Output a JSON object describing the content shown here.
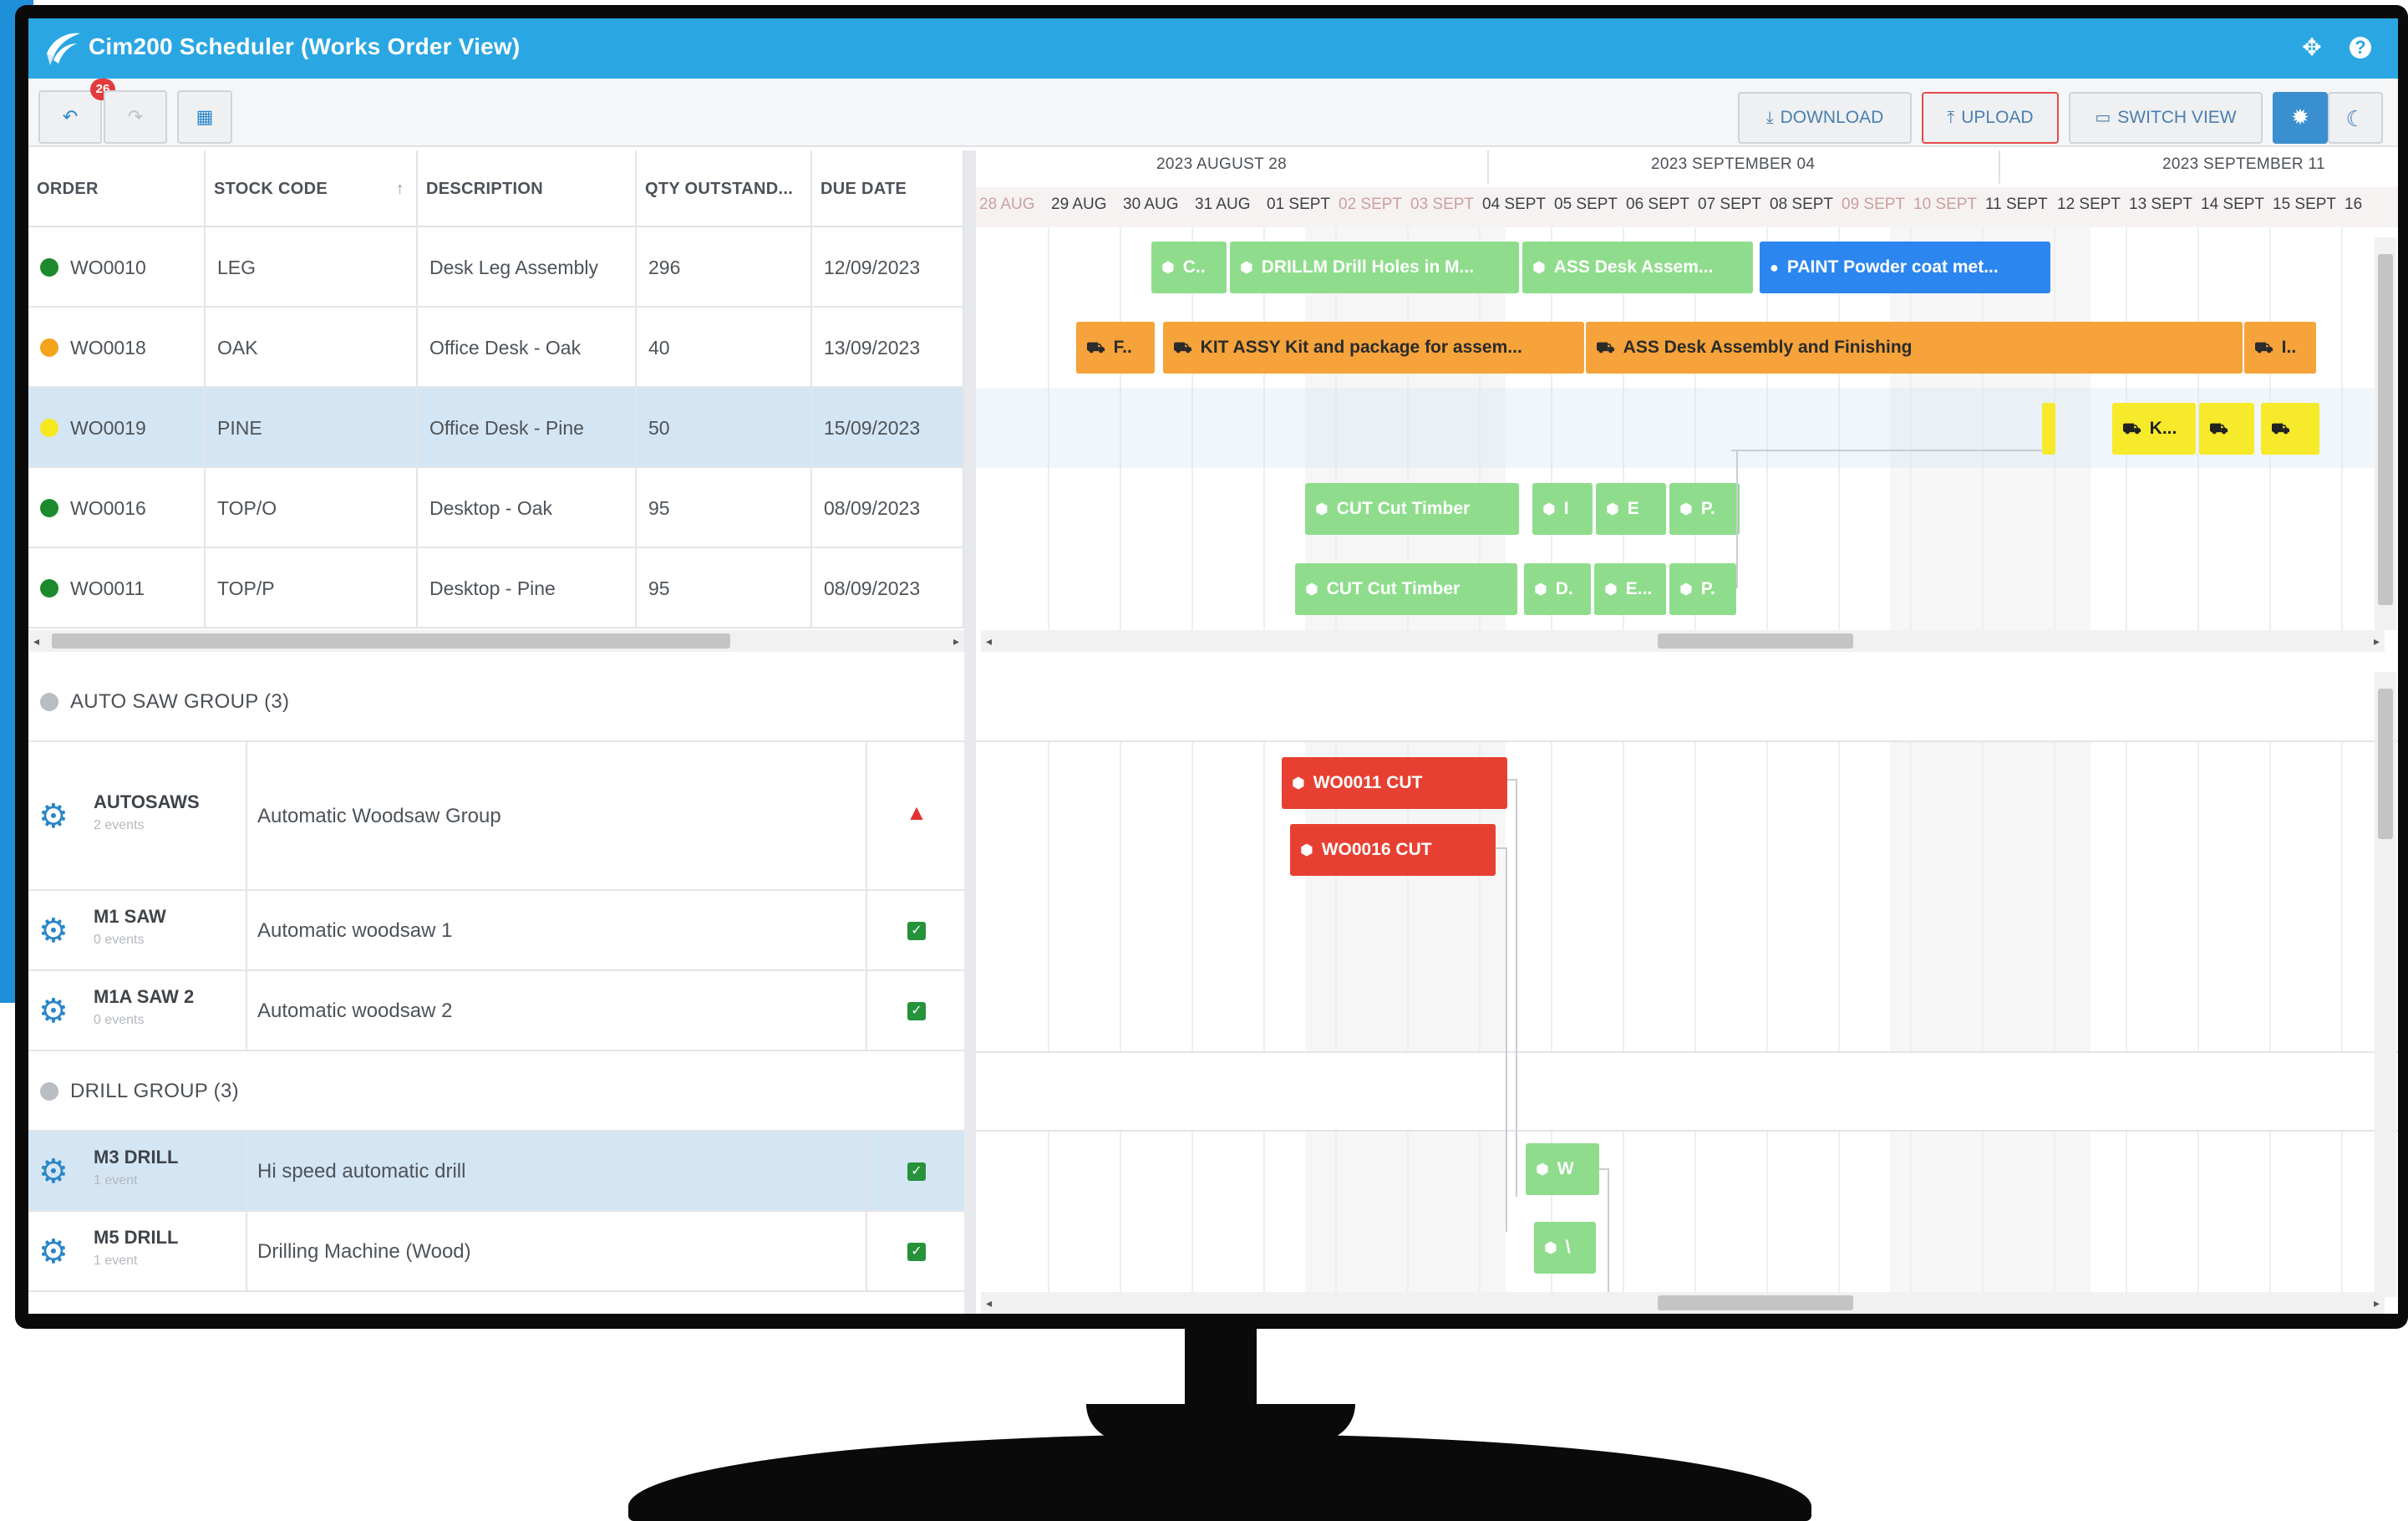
{
  "app": {
    "title": "Cim200 Scheduler (Works Order View)"
  },
  "toolbar": {
    "undo_badge": "26",
    "download": "DOWNLOAD",
    "upload": "UPLOAD",
    "switch_view": "SWITCH VIEW"
  },
  "grid": {
    "columns": [
      "ORDER",
      "STOCK CODE",
      "DESCRIPTION",
      "QTY OUTSTAND...",
      "DUE DATE"
    ],
    "rows": [
      {
        "order": "WO0010",
        "stock": "LEG",
        "desc": "Desk Leg Assembly",
        "qty": "296",
        "due": "12/09/2023",
        "status_color": "#1c8a2c"
      },
      {
        "order": "WO0018",
        "stock": "OAK",
        "desc": "Office Desk - Oak",
        "qty": "40",
        "due": "13/09/2023",
        "status_color": "#f4a31c"
      },
      {
        "order": "WO0019",
        "stock": "PINE",
        "desc": "Office Desk - Pine",
        "qty": "50",
        "due": "15/09/2023",
        "status_color": "#f6e81c"
      },
      {
        "order": "WO0016",
        "stock": "TOP/O",
        "desc": "Desktop - Oak",
        "qty": "95",
        "due": "08/09/2023",
        "status_color": "#1c8a2c"
      },
      {
        "order": "WO0011",
        "stock": "TOP/P",
        "desc": "Desktop - Pine",
        "qty": "95",
        "due": "08/09/2023",
        "status_color": "#1c8a2c"
      }
    ]
  },
  "timeline": {
    "weeks": [
      "2023 AUGUST 28",
      "2023 SEPTEMBER 04",
      "2023 SEPTEMBER 11"
    ],
    "days": [
      "28 AUG",
      "29 AUG",
      "30 AUG",
      "31 AUG",
      "01 SEPT",
      "02 SEPT",
      "03 SEPT",
      "04 SEPT",
      "05 SEPT",
      "06 SEPT",
      "07 SEPT",
      "08 SEPT",
      "09 SEPT",
      "10 SEPT",
      "11 SEPT",
      "12 SEPT",
      "13 SEPT",
      "14 SEPT",
      "15 SEPT",
      "16"
    ],
    "bars": {
      "r1": [
        "C..",
        "DRILLM Drill Holes in M...",
        "ASS Desk Assem...",
        "PAINT Powder coat met..."
      ],
      "r2": [
        "F..",
        "KIT ASSY Kit and package for assem...",
        "ASS Desk Assembly and Finishing",
        "I.."
      ],
      "r3": [
        "K...",
        ""
      ],
      "r4": [
        "CUT Cut Timber",
        "I",
        "E",
        "P."
      ],
      "r5": [
        "CUT Cut Timber",
        "D.",
        "E...",
        "P."
      ]
    }
  },
  "resources": {
    "groups": [
      "AUTO SAW GROUP (3)",
      "DRILL GROUP (3)"
    ],
    "items": [
      {
        "name": "AUTOSAWS",
        "events": "2 events",
        "desc": "Automatic Woodsaw Group",
        "status": "warn"
      },
      {
        "name": "M1 SAW",
        "events": "0 events",
        "desc": "Automatic woodsaw 1",
        "status": "ok"
      },
      {
        "name": "M1A SAW 2",
        "events": "0 events",
        "desc": "Automatic woodsaw 2",
        "status": "ok"
      },
      {
        "name": "M3 DRILL",
        "events": "1 event",
        "desc": "Hi speed automatic drill",
        "status": "ok"
      },
      {
        "name": "M5 DRILL",
        "events": "1 event",
        "desc": "Drilling Machine (Wood)",
        "status": "ok"
      }
    ],
    "events": [
      "WO0011 CUT",
      "WO0016 CUT",
      "W",
      "\\"
    ]
  }
}
